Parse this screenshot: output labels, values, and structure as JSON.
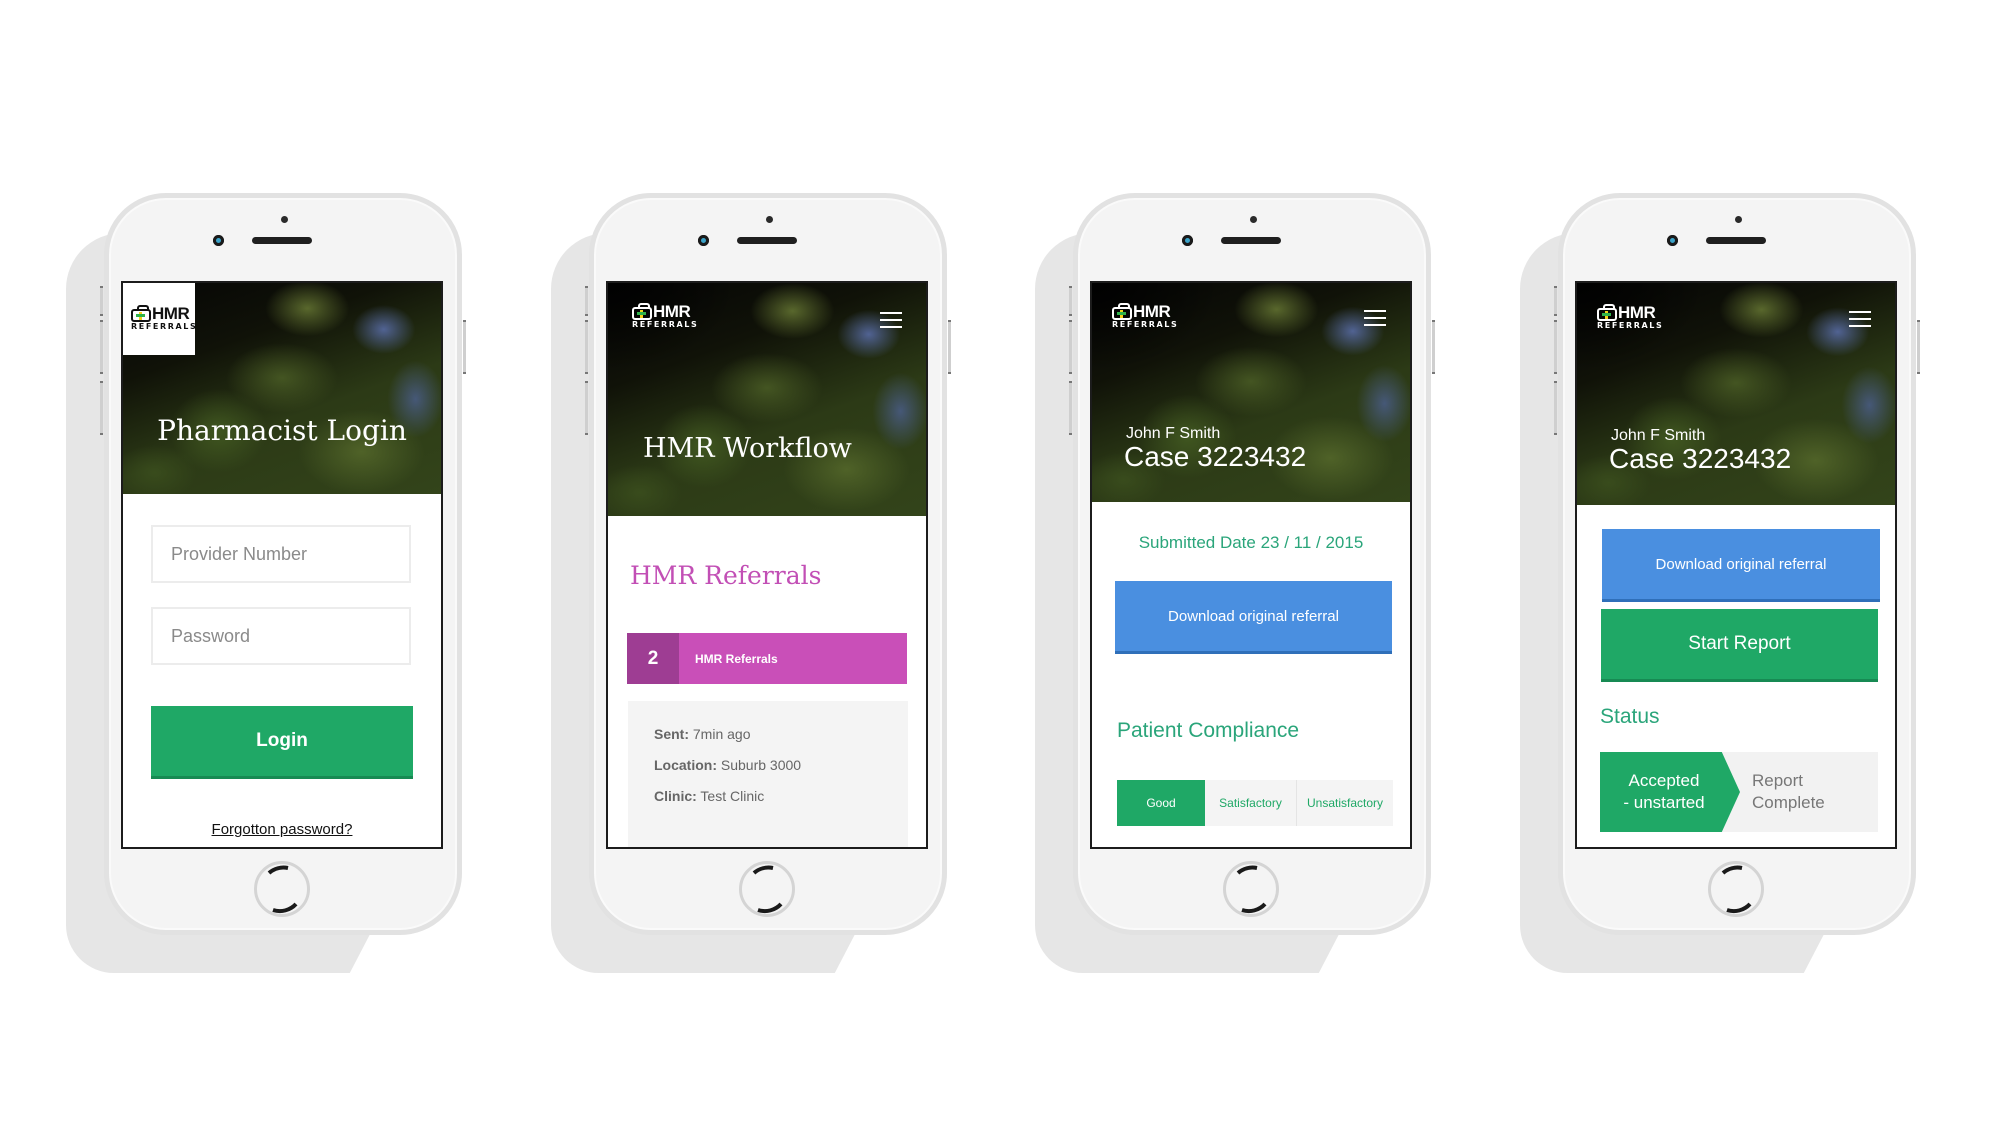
{
  "brand": {
    "logo_top": "HMR",
    "logo_bottom": "REFERRALS",
    "colors": {
      "green": "#1fa866",
      "blue": "#4a8fe0",
      "magenta": "#c94fb8",
      "magenta_dark": "#9e3d93",
      "teal_text": "#2aa57a"
    }
  },
  "icons": {
    "menu": "hamburger-icon",
    "logo": "medical-bag-icon"
  },
  "screens": {
    "login": {
      "title": "Pharmacist Login",
      "provider_placeholder": "Provider Number",
      "password_placeholder": "Password",
      "login_label": "Login",
      "forgot_label": "Forgotton password?"
    },
    "workflow": {
      "title": "HMR Workflow",
      "section_title": "HMR Referrals",
      "badge_count": "2",
      "badge_label": "HMR Referrals",
      "card": {
        "sent_label": "Sent:",
        "sent_value": "7min ago",
        "location_label": "Location:",
        "location_value": "Suburb 3000",
        "clinic_label": "Clinic:",
        "clinic_value": "Test Clinic"
      }
    },
    "case_compliance": {
      "patient_name": "John F Smith",
      "case_title": "Case 3223432",
      "submitted": "Submitted Date 23 / 11 / 2015",
      "download_label": "Download original referral",
      "compliance_title": "Patient Compliance",
      "compliance_options": [
        "Good",
        "Satisfactory",
        "Unsatisfactory"
      ],
      "compliance_selected": "Good"
    },
    "case_status": {
      "patient_name": "John F Smith",
      "case_title": "Case 3223432",
      "download_label": "Download original referral",
      "start_report_label": "Start Report",
      "status_title": "Status",
      "status_steps": [
        "Accepted\n- unstarted",
        "Report\nComplete"
      ],
      "status_current": "Accepted - unstarted"
    }
  }
}
